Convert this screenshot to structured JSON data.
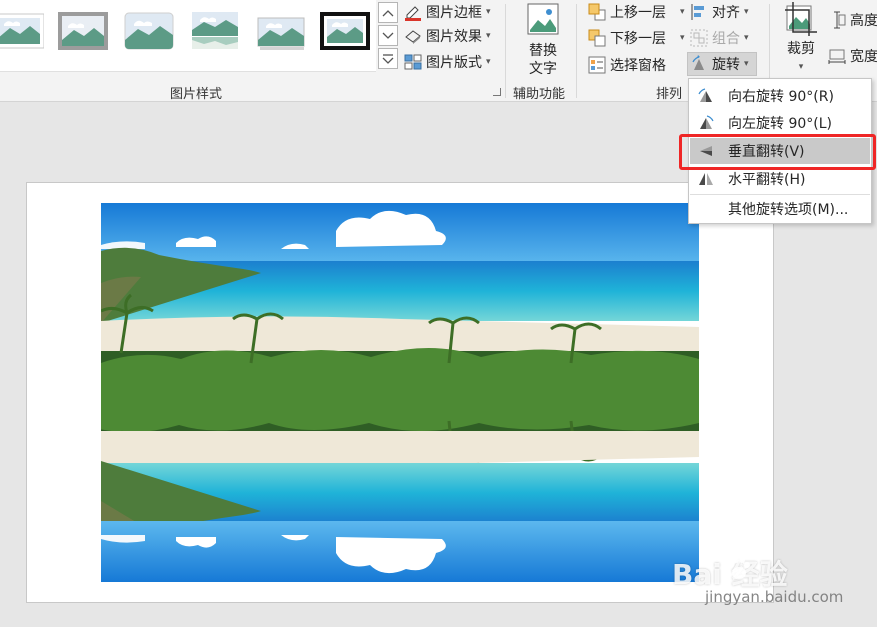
{
  "ribbon": {
    "groups": {
      "picture_styles": "图片样式",
      "accessibility": "辅助功能",
      "arrange": "排列"
    },
    "picture_style_cmds": {
      "border": "图片边框",
      "effects": "图片效果",
      "layout": "图片版式"
    },
    "alt_text": {
      "line1": "替换",
      "line2": "文字"
    },
    "arrange_cmds": {
      "bring_forward": "上移一层",
      "send_backward": "下移一层",
      "selection_pane": "选择窗格",
      "align": "对齐",
      "group": "组合",
      "rotate": "旋转"
    },
    "crop": "裁剪",
    "height": "高度",
    "width": "宽度"
  },
  "rotate_menu": {
    "items": [
      {
        "label": "向右旋转 90°(R)"
      },
      {
        "label": "向左旋转 90°(L)"
      },
      {
        "label": "垂直翻转(V)"
      },
      {
        "label": "水平翻转(H)"
      },
      {
        "label": "其他旋转选项(M)..."
      }
    ]
  },
  "watermark": {
    "brand": "Bai  经验",
    "url": "jingyan.baidu.com"
  },
  "colors": {
    "accent_red": "#ef2626",
    "sky": "#1e8fe0",
    "sea": "#18a9d6"
  }
}
